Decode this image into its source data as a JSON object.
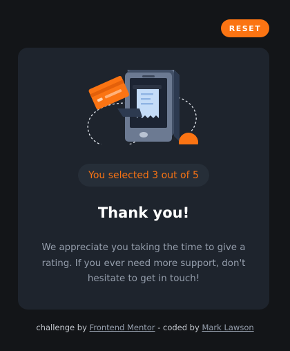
{
  "header": {
    "reset_label": "RESET"
  },
  "card": {
    "illustration_icon": "payment-phone-illustration",
    "selection_text": "You selected 3 out of 5",
    "rating_selected": 3,
    "rating_max": 5,
    "title": "Thank you!",
    "message": "We appreciate you taking the time to give a rating. If you ever need more support, don't hesitate to get in touch!"
  },
  "footer": {
    "prefix": "challenge by",
    "challenge_link": "Frontend Mentor",
    "middle": "- coded by",
    "author_link": "Mark Lawson"
  },
  "colors": {
    "background": "#131518",
    "card": "#1e242d",
    "accent": "#fb7413",
    "pill": "#262e38",
    "muted_text": "#959eac"
  }
}
